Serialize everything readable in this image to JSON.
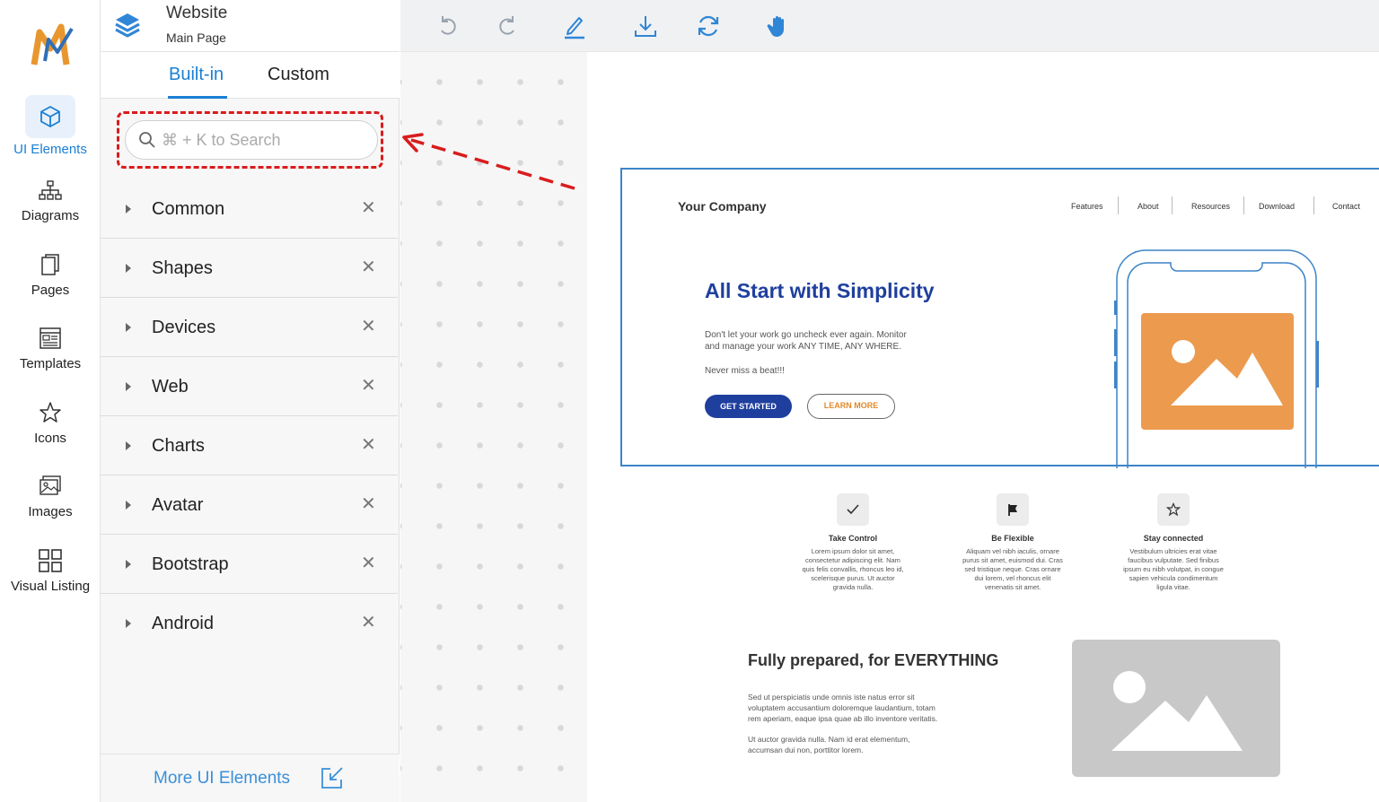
{
  "rail": {
    "items": [
      {
        "label": "UI Elements",
        "icon": "cube-icon",
        "active": true
      },
      {
        "label": "Diagrams",
        "icon": "sitemap-icon"
      },
      {
        "label": "Pages",
        "icon": "pages-icon"
      },
      {
        "label": "Templates",
        "icon": "template-icon"
      },
      {
        "label": "Icons",
        "icon": "star-icon"
      },
      {
        "label": "Images",
        "icon": "images-icon"
      },
      {
        "label": "Visual Listing",
        "icon": "grid-icon"
      }
    ]
  },
  "panel": {
    "project_title": "Website",
    "project_subtitle": "Main Page",
    "tabs": [
      "Built-in",
      "Custom"
    ],
    "search_placeholder": "⌘ + K to Search",
    "categories": [
      "Common",
      "Shapes",
      "Devices",
      "Web",
      "Charts",
      "Avatar",
      "Bootstrap",
      "Android"
    ],
    "more_label": "More UI Elements"
  },
  "toolbar": {
    "buttons": [
      "undo-icon",
      "redo-icon",
      "pen-icon",
      "download-icon",
      "refresh-icon",
      "hand-icon"
    ]
  },
  "mock": {
    "brand": "Your Company",
    "nav": [
      "Features",
      "About",
      "Resources",
      "Download",
      "Contact"
    ],
    "hero_title": "All Start with Simplicity",
    "hero_text_1": "Don't let your work go uncheck ever again. Monitor",
    "hero_text_2": "and manage your work ANY TIME, ANY WHERE.",
    "hero_text_3": "Never miss a beat!!!",
    "btn_start": "GET STARTED",
    "btn_learn": "LEARN MORE",
    "features": [
      {
        "title": "Take Control",
        "lines": [
          "Lorem ipsum dolor sit amet,",
          "consectetur adipiscing elit. Nam",
          "quis felis convallis, rhoncus leo id,",
          "scelerisque purus. Ut auctor",
          "gravida nulla."
        ]
      },
      {
        "title": "Be Flexible",
        "lines": [
          "Aliquam vel nibh iaculis, ornare",
          "purus sit amet, euismod dui. Cras",
          "sed tristique neque. Cras ornare",
          "dui lorem, vel rhoncus elit",
          "venenatis sit amet."
        ]
      },
      {
        "title": "Stay connected",
        "lines": [
          "Vestibulum ultricies erat vitae",
          "faucibus vulputate. Sed finibus",
          "ipsum eu nibh volutpat, in congue",
          "sapien vehicula condimentum",
          "ligula vitae."
        ]
      }
    ],
    "sec2_title": "Fully prepared, for EVERYTHING",
    "sec2_p1": [
      "Sed ut perspiciatis unde omnis iste natus error sit",
      "voluptatem accusantium doloremque laudantium, totam",
      "rem aperiam, eaque ipsa quae ab illo inventore veritatis."
    ],
    "sec2_p2": [
      "Ut auctor gravida nulla. Nam id erat elementum,",
      "accumsan dui non, porttitor lorem."
    ]
  },
  "colors": {
    "accent": "#1a7fd4",
    "highlight": "#d91c1c",
    "hero_title": "#1f3f9e",
    "image_orange": "#ec9a4e"
  }
}
